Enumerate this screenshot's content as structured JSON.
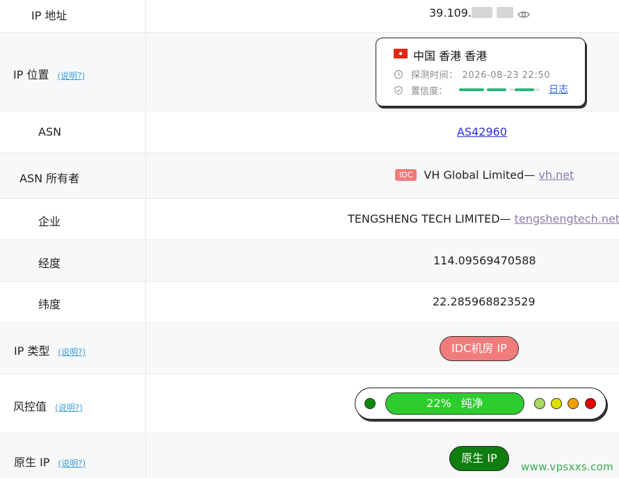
{
  "rows": {
    "ip_address": {
      "label": "IP 地址",
      "value_prefix": "39.109."
    },
    "ip_location": {
      "label": "IP 位置",
      "help": "(说明?)",
      "location": "中国 香港 香港",
      "probe_label": "探测时间：",
      "probe_time": "2026-08-23 22:50",
      "confidence_label": "置信度：",
      "log_link": "日志"
    },
    "asn": {
      "label": "ASN",
      "value": "AS42960"
    },
    "asn_owner": {
      "label": "ASN 所有者",
      "tag": "IDC",
      "name": "VH Global Limited— ",
      "domain": "vh.net"
    },
    "company": {
      "label": "企业",
      "name": "TENGSHENG TECH LIMITED— ",
      "domain": "tengshengtech.net"
    },
    "longitude": {
      "label": "经度",
      "value": "114.09569470588"
    },
    "latitude": {
      "label": "纬度",
      "value": "22.285968823529"
    },
    "ip_type": {
      "label": "IP 类型",
      "help": "(说明?)",
      "value": "IDC机房 IP"
    },
    "risk": {
      "label": "风控值",
      "help": "(说明?)",
      "value": "22%",
      "verdict": "纯净",
      "level_percent": 22
    },
    "native_ip": {
      "label": "原生 IP",
      "help": "(说明?)",
      "value": "原生 IP"
    }
  },
  "colors": {
    "flag": "#de2910",
    "confidence": "#2bb673",
    "idc_tag": "#ef7b7b",
    "ip_type_pill": "#f07c7c",
    "risk_bar": "#2ecc2e",
    "native_pill": "#0f7d0f",
    "dots": [
      "#0a8a0a",
      "#a8d860",
      "#e0e000",
      "#f0a000",
      "#e00000"
    ]
  },
  "watermark": "www.vpsxxs.com"
}
